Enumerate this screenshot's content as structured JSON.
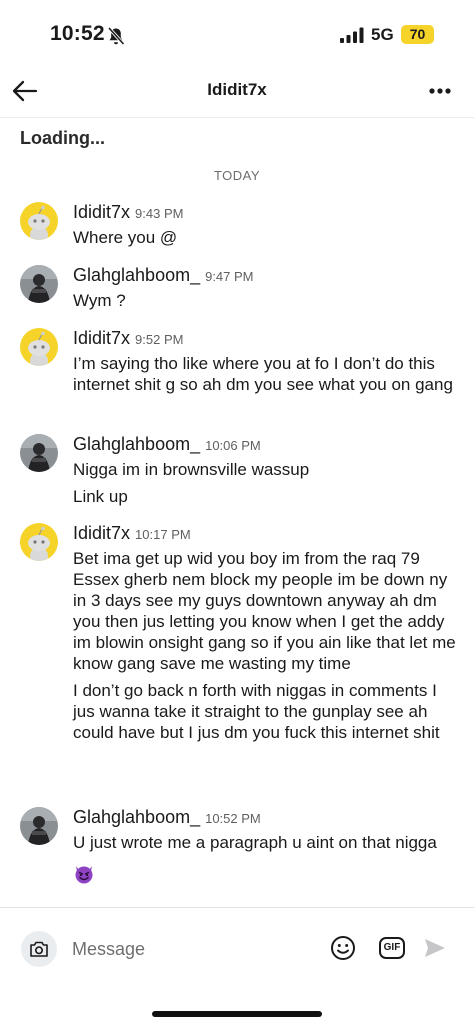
{
  "status_bar": {
    "time": "10:52",
    "network": "5G",
    "battery": "70",
    "battery_color": "#f5d328",
    "icons": [
      "bell-slash-icon",
      "signal-bars-icon"
    ]
  },
  "header": {
    "title": "Ididit7x",
    "back_icon": "arrow-left-icon",
    "more_icon": "ellipsis-icon"
  },
  "loading_text": "Loading...",
  "day_separator": "TODAY",
  "messages": [
    {
      "user": "Ididit7x",
      "time": "9:43 PM",
      "avatar": "snoo-yellow-avatar",
      "lines": [
        "Where you @"
      ]
    },
    {
      "user": "Glahglahboom_",
      "time": "9:47 PM",
      "avatar": "photo-avatar",
      "lines": [
        "Wym ?"
      ]
    },
    {
      "user": "Ididit7x",
      "time": "9:52 PM",
      "avatar": "snoo-yellow-avatar",
      "lines": [
        "I’m saying tho like where you at fo I don’t do this internet shit g so ah dm you see what you on gang"
      ]
    },
    {
      "user": "Glahglahboom_",
      "time": "10:06 PM",
      "avatar": "photo-avatar",
      "lines": [
        "Nigga im in brownsville wassup",
        "Link up"
      ]
    },
    {
      "user": "Ididit7x",
      "time": "10:17 PM",
      "avatar": "snoo-yellow-avatar",
      "lines": [
        "Bet ima get up wid you boy im from the raq 79 Essex gherb nem block my people im be down ny in 3 days see my guys downtown anyway ah dm you then jus letting you know when I get the addy im blowin onsight gang so if you ain like that let me know gang save me wasting my time",
        "I don’t go back n forth with niggas in comments I jus wanna take it straight to the gunplay see ah could have but I jus dm you fuck this internet shit"
      ]
    },
    {
      "user": "Glahglahboom_",
      "time": "10:52 PM",
      "avatar": "photo-avatar",
      "lines": [
        "U just wrote me a paragraph u aint on that nigga"
      ],
      "emoji": "smiling-devil-emoji"
    }
  ],
  "composer": {
    "placeholder": "Message",
    "gif_label": "GIF",
    "icons": [
      "camera-icon",
      "smiley-icon",
      "gif-icon",
      "send-icon"
    ]
  },
  "colors": {
    "snoo_avatar_bg": "#f5d328",
    "devil_emoji": "#8e44c2",
    "muted_text": "#6d6d70"
  }
}
